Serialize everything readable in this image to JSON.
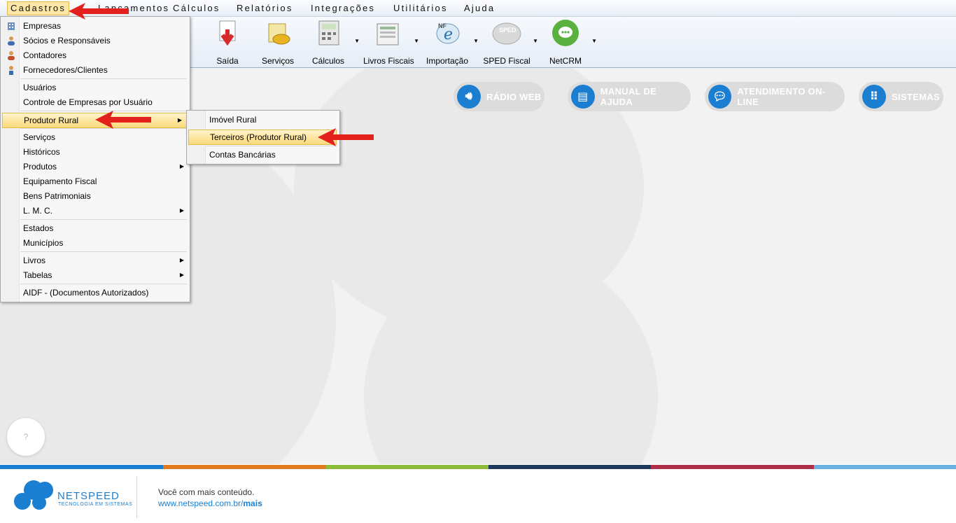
{
  "menubar": {
    "items": [
      {
        "label": "Cadastros"
      },
      {
        "label": "Lançamentos"
      },
      {
        "label": "Cálculos"
      },
      {
        "label": "Relatórios"
      },
      {
        "label": "Integrações"
      },
      {
        "label": "Utilitários"
      },
      {
        "label": "Ajuda"
      }
    ]
  },
  "toolbar": {
    "buttons": [
      {
        "label": "Saída",
        "icon": "saida-icon"
      },
      {
        "label": "Serviços",
        "icon": "servicos-icon"
      },
      {
        "label": "Cálculos",
        "icon": "calculos-icon"
      },
      {
        "label": "Livros Fiscais",
        "icon": "livros-fiscais-icon"
      },
      {
        "label": "Importação",
        "icon": "nfe-import-icon"
      },
      {
        "label": "SPED Fiscal",
        "icon": "sped-icon"
      },
      {
        "label": "NetCRM",
        "icon": "netcrm-icon"
      }
    ]
  },
  "cadastros_menu": {
    "items": [
      {
        "label": "Empresas",
        "key": "E"
      },
      {
        "label": "Sócios e Responsáveis",
        "key": "S"
      },
      {
        "label": "Contadores",
        "key": "C"
      },
      {
        "label": "Fornecedores/Clientes",
        "key": "F"
      },
      {
        "label": "Usuários",
        "key": "U"
      },
      {
        "label": "Controle de Empresas por Usuário"
      },
      {
        "label": "Produtor Rural",
        "key": "P"
      },
      {
        "label": "Serviços",
        "key": "S"
      },
      {
        "label": "Históricos",
        "key": "H"
      },
      {
        "label": "Produtos",
        "key": "P"
      },
      {
        "label": "Equipamento Fiscal"
      },
      {
        "label": "Bens Patrimoniais",
        "key": "B"
      },
      {
        "label": "L. M. C.",
        "key": "L"
      },
      {
        "label": "Estados"
      },
      {
        "label": "Municípios",
        "key": "M"
      },
      {
        "label": "Livros",
        "key": "L"
      },
      {
        "label": "Tabelas",
        "key": "T"
      },
      {
        "label": "AIDF - (Documentos Autorizados)",
        "key": "A"
      }
    ]
  },
  "produtor_rural_submenu": {
    "items": [
      {
        "label": "Imóvel Rural"
      },
      {
        "label": "Terceiros (Produtor Rural)"
      },
      {
        "label": "Contas Bancárias"
      }
    ]
  },
  "quick_links": [
    {
      "label": "RÁDIO WEB",
      "icon": "speaker-icon"
    },
    {
      "label": "MANUAL DE AJUDA",
      "icon": "book-icon"
    },
    {
      "label": "ATENDIMENTO ON-LINE",
      "icon": "chat-icon"
    },
    {
      "label": "SISTEMAS",
      "icon": "grid-icon"
    }
  ],
  "help_button": {
    "label": "?"
  },
  "footer": {
    "brand": "NETSPEED",
    "brand_sub": "TECNOLOGIA EM SISTEMAS",
    "tagline": "Você com mais conteúdo.",
    "url_prefix": "www.netspeed.com.br/",
    "url_suffix": "mais"
  },
  "colors": {
    "accent_blue": "#1c7ed0",
    "menu_highlight": "#fbd97a",
    "stripe": [
      "#1a7fd1",
      "#e07b20",
      "#8dbb3a",
      "#1e3a5c",
      "#b0304a",
      "#6ab0e0"
    ]
  }
}
